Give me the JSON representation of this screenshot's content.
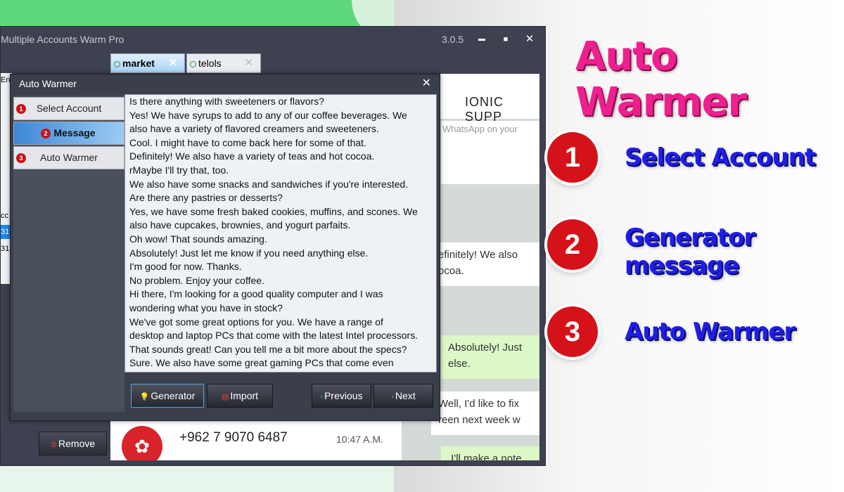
{
  "window": {
    "title": "Multiple Accounts Warm Pro",
    "version": "3.0.5",
    "minimize": "▬",
    "maximize": "■",
    "close": "✕"
  },
  "tabs": [
    {
      "label": "market",
      "close": "✕"
    },
    {
      "label": "telols",
      "close": "✕"
    }
  ],
  "left_strip": {
    "top_label": "Eng",
    "column_label": "cc",
    "rows": [
      "31",
      "31"
    ]
  },
  "remove_button": "Remove",
  "chat": {
    "contact_name": "IONIC SUPP",
    "subtitle": "WhatsApp on your",
    "bubbles": [
      "efinitely! We also\nocoa.",
      "Absolutely! Just\nelse.",
      "Well, I'd like to fix\nreen next week w",
      ",I'll make a note\nconfirm the app"
    ],
    "contact_item": {
      "number": "+962 7 9070 6487",
      "time": "10:47 A.M."
    }
  },
  "dialog": {
    "title": "Auto Warmer",
    "close": "✕",
    "nav": [
      {
        "num": "1",
        "label": "Select Account"
      },
      {
        "num": "2",
        "label": "Message"
      },
      {
        "num": "3",
        "label": "Auto Warmer"
      }
    ],
    "messages": [
      "Is there anything with sweeteners or flavors?",
      "Yes! We have syrups to add to any of our coffee beverages. We",
      "also have a variety of flavored creamers and sweeteners.",
      "Cool. I might have to come back here for some of that.",
      "Definitely! We also have a variety of teas and hot cocoa.",
      "rMaybe I'll try that, too.",
      "We also have some snacks and sandwiches if you're interested.",
      "Are there any pastries or desserts?",
      "Yes, we have some fresh baked cookies, muffins, and scones. We",
      "also have cupcakes, brownies, and yogurt parfaits.",
      "Oh wow! That sounds amazing.",
      "Absolutely! Just let me know if you need anything else.",
      "I'm good for now. Thanks.",
      "No problem. Enjoy your coffee.",
      "Hi there, I'm looking for a good quality computer and I was",
      "wondering what you have in stock?",
      "We've got some great options for you. We have a range of",
      "desktop and laptop PCs that come with the latest Intel processors.",
      "That sounds great! Can you tell me a bit more about the specs?",
      "Sure. We also have some great gaming PCs that come even"
    ],
    "buttons": {
      "generator": "Generator",
      "import": "Import",
      "previous": "Previous",
      "next": "Next"
    }
  },
  "promo": {
    "headline": "Auto Warmer",
    "features": [
      {
        "num": "1",
        "label": "Select Account"
      },
      {
        "num": "2",
        "label": "Generator message"
      },
      {
        "num": "3",
        "label": "Auto Warmer"
      }
    ]
  },
  "colors": {
    "headline": "#ef1f8d",
    "feature_text": "#1f1de8",
    "badge": "#d5121a",
    "window_bg": "#3d4150",
    "active_nav": "#3d87d6"
  }
}
